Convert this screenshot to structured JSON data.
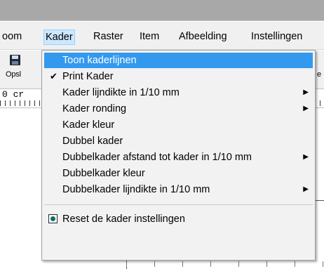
{
  "menubar": {
    "items": [
      {
        "label": "oom"
      },
      {
        "label": "Kader"
      },
      {
        "label": "Raster"
      },
      {
        "label": "Item"
      },
      {
        "label": "Afbeelding"
      },
      {
        "label": "Instellingen"
      }
    ]
  },
  "toolbar": {
    "save_label": "Opsl",
    "right_label": "e"
  },
  "ruler": {
    "text": "0  cr"
  },
  "kader_menu": {
    "items": [
      {
        "label": "Toon kaderlijnen",
        "highlighted": true
      },
      {
        "label": "Print Kader",
        "check": "✔"
      },
      {
        "label": "Kader lijndikte in 1/10 mm",
        "arrow": "▶"
      },
      {
        "label": "Kader ronding",
        "arrow": "▶"
      },
      {
        "label": "Kader kleur"
      },
      {
        "label": "Dubbel kader"
      },
      {
        "label": "Dubbelkader afstand tot kader in 1/10 mm",
        "arrow": "▶"
      },
      {
        "label": "Dubbelkader kleur"
      },
      {
        "label": "Dubbelkader lijndikte in 1/10 mm",
        "arrow": "▶"
      },
      {
        "label": "Reset de kader instellingen"
      }
    ]
  },
  "colors": {
    "highlight": "#3399ee",
    "menu_open": "#cce8ff",
    "radio_dot": "#0a6e6e"
  }
}
